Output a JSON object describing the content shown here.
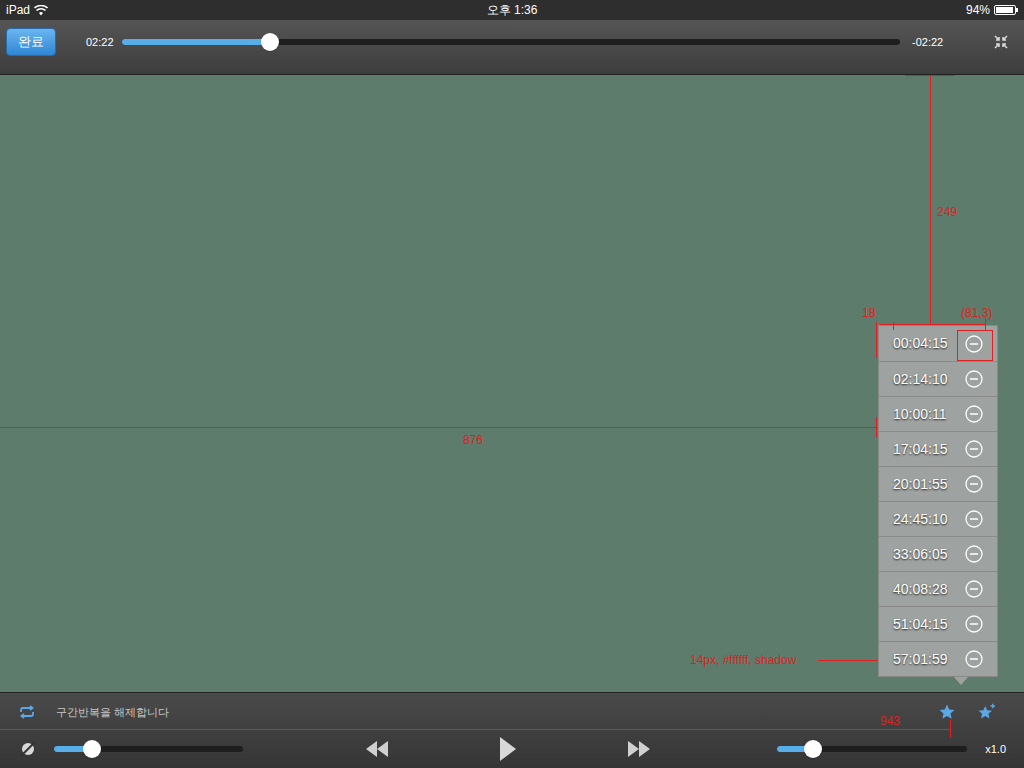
{
  "status_bar": {
    "device": "iPad",
    "time": "오후 1:36",
    "battery": "94%",
    "battery_level": 0.94
  },
  "top_bar": {
    "done_button": "완료",
    "elapsed": "02:22",
    "remaining": "-02:22",
    "progress": {
      "level": 0.19
    }
  },
  "bookmarks": {
    "items": [
      {
        "time": "00:04:15"
      },
      {
        "time": "02:14:10"
      },
      {
        "time": "10:00:11"
      },
      {
        "time": "17:04:15"
      },
      {
        "time": "20:01:55"
      },
      {
        "time": "24:45:10"
      },
      {
        "time": "33:06:05"
      },
      {
        "time": "40:08:28"
      },
      {
        "time": "51:04:15"
      },
      {
        "time": "57:01:59"
      }
    ]
  },
  "bottom_bar": {
    "repeat_message": "구간반복을 해제합니다",
    "bookmark_button": {
      "selected": true
    },
    "brightness": {
      "level": 0.2
    },
    "volume": {
      "level": 0.19
    },
    "speed": "x1.0"
  },
  "annotations": [
    {
      "label": "249"
    },
    {
      "label": "18"
    },
    {
      "label": "(81,3)"
    },
    {
      "label": "876"
    },
    {
      "label": "14px, #ffffff, shadow"
    },
    {
      "label": "943"
    }
  ]
}
